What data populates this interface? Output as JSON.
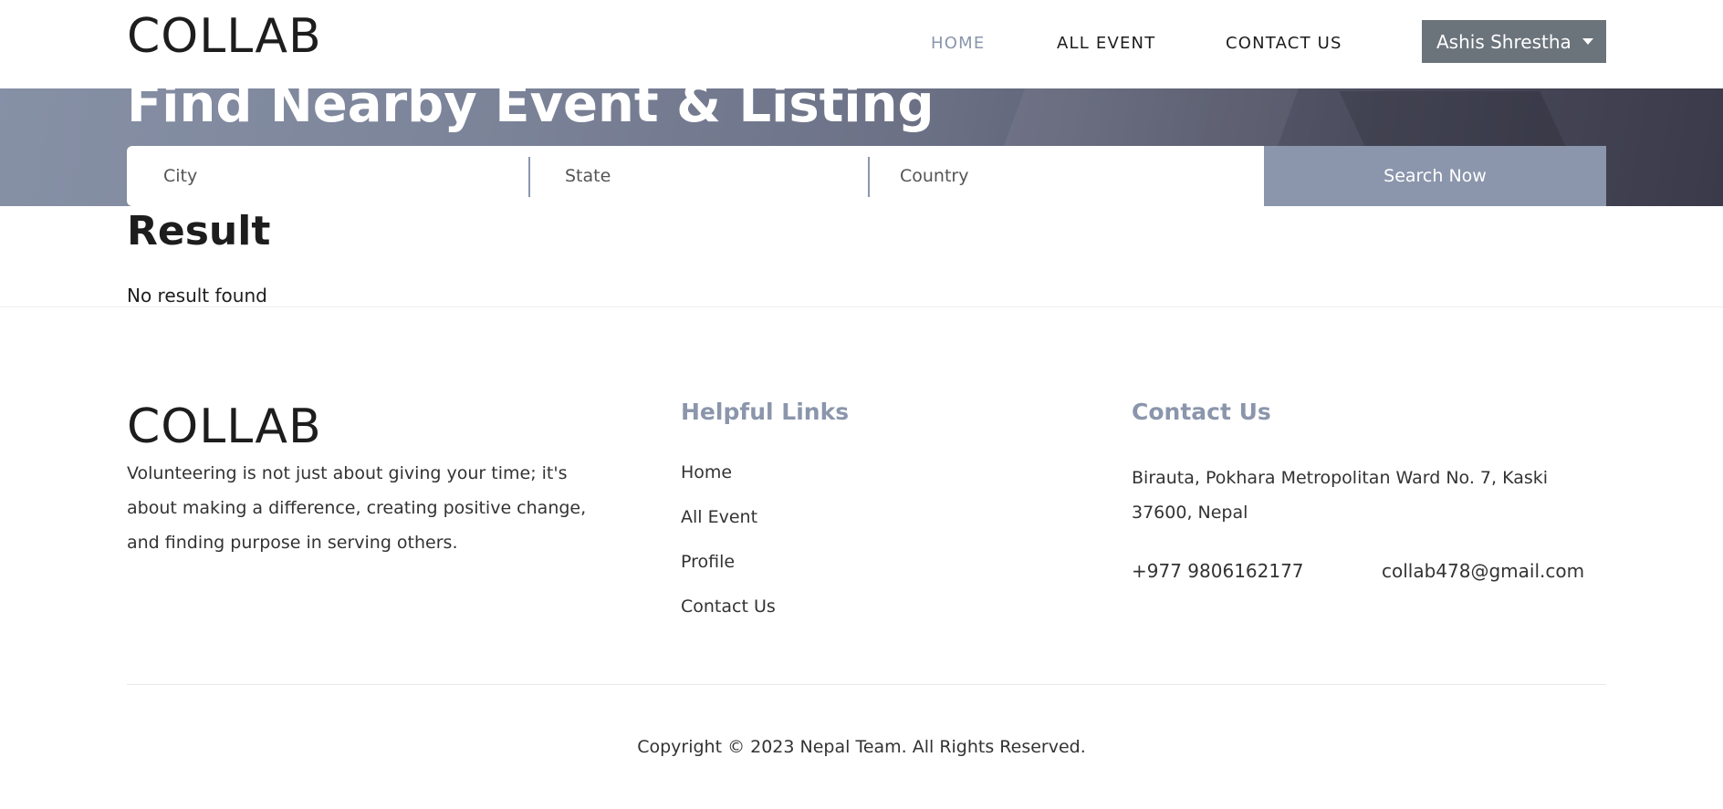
{
  "brand": "COLLAB",
  "nav": {
    "home": "HOME",
    "all_event": "ALL EVENT",
    "contact_us": "CONTACT US",
    "user_name": "Ashis Shrestha"
  },
  "hero": {
    "title": "Find Nearby Event & Listing"
  },
  "search": {
    "city_placeholder": "City",
    "state_placeholder": "State",
    "country_placeholder": "Country",
    "button_label": "Search Now"
  },
  "result": {
    "title": "Result",
    "message": "No result found"
  },
  "footer": {
    "brand": "COLLAB",
    "description": "Volunteering is not just about giving your time; it's about making a difference, creating positive change, and finding purpose in serving others.",
    "links_heading": "Helpful Links",
    "links": [
      "Home",
      "All Event",
      "Profile",
      "Contact Us"
    ],
    "contact_heading": "Contact Us",
    "address": "Birauta, Pokhara Metropolitan Ward No. 7, Kaski 37600, Nepal",
    "phone": "+977 9806162177",
    "email": "collab478@gmail.com",
    "copyright": "Copyright © 2023 Nepal Team. All Rights Reserved."
  },
  "colors": {
    "accent": "#8b96ac",
    "user_button": "#6b737b"
  }
}
